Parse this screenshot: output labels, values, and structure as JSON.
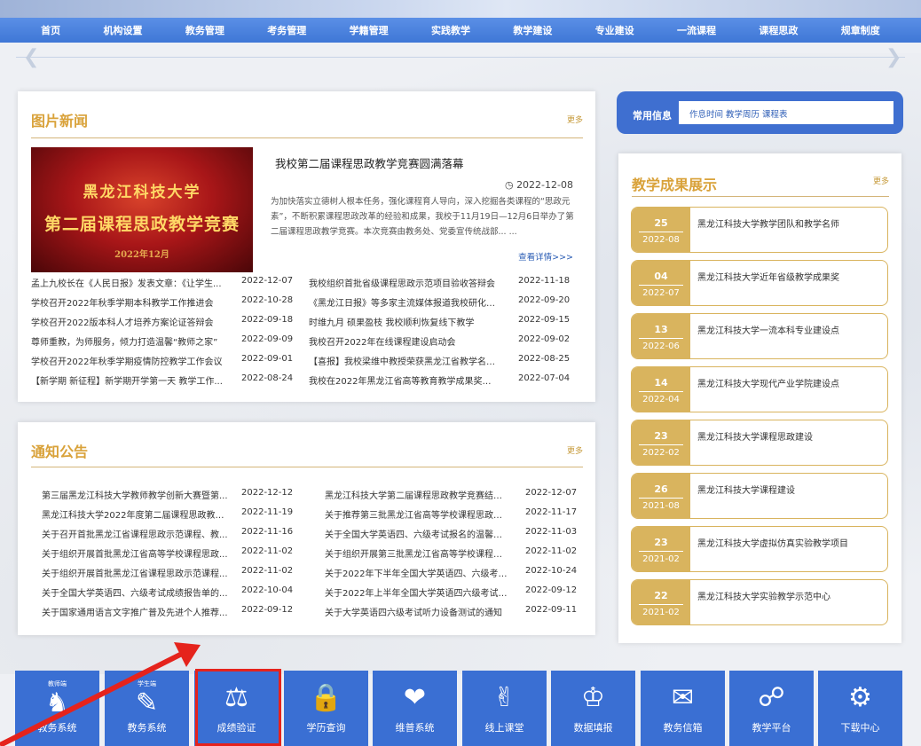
{
  "nav": [
    "首页",
    "机构设置",
    "教务管理",
    "考务管理",
    "学籍管理",
    "实践教学",
    "教学建设",
    "专业建设",
    "一流课程",
    "课程思政",
    "规章制度"
  ],
  "picnews": {
    "title": "图片新闻",
    "more": "更多",
    "feature": {
      "img_line1": "黑龙江科技大学",
      "img_line2": "第二届课程思政教学竞赛",
      "img_line3": "2022年12月",
      "title": "我校第二届课程思政教学竞赛圆满落幕",
      "date": "2022-12-08",
      "body": "为加快落实立德树人根本任务，强化课程育人导向，深入挖掘各类课程的“思政元素”，不断积累课程思政改革的经验和成果，我校于11月19日—12月6日举办了第二届课程思政教学竞赛。本次竞赛由教务处、党委宣传统战部...    ...",
      "detail": "查看详情>>>"
    },
    "items": [
      {
        "t": "孟上九校长在《人民日报》发表文章：《让学生...",
        "d": "2022-12-07"
      },
      {
        "t": "我校组织首批省级课程思政示范项目验收答辩会",
        "d": "2022-11-18"
      },
      {
        "t": "学校召开2022年秋季学期本科教学工作推进会",
        "d": "2022-10-28"
      },
      {
        "t": "《黑龙江日报》等多家主流媒体报道我校研化学...",
        "d": "2022-09-20"
      },
      {
        "t": "学校召开2022版本科人才培养方案论证答辩会",
        "d": "2022-09-18"
      },
      {
        "t": "时维九月 硕果盈枝 我校顺利恢复线下教学",
        "d": "2022-09-15"
      },
      {
        "t": "尊师重教，为师服务，倾力打造温馨“教师之家”",
        "d": "2022-09-09"
      },
      {
        "t": "我校召开2022年在线课程建设启动会",
        "d": "2022-09-02"
      },
      {
        "t": "学校召开2022年秋季学期疫情防控教学工作会议",
        "d": "2022-09-01"
      },
      {
        "t": "【喜报】我校梁维中教授荣获黑龙江省教学名师奖",
        "d": "2022-08-25"
      },
      {
        "t": "【新学期 新征程】新学期开学第一天 教学工作...",
        "d": "2022-08-24"
      },
      {
        "t": "我校在2022年黑龙江省高等教育教学成果奖评...",
        "d": "2022-07-04"
      }
    ]
  },
  "notice": {
    "title": "通知公告",
    "more": "更多",
    "items": [
      {
        "t": "第三届黑龙江科技大学教师教学创新大赛暨第...",
        "d": "2022-12-12"
      },
      {
        "t": "黑龙江科技大学第二届课程思政教学竞赛结果...",
        "d": "2022-12-07"
      },
      {
        "t": "黑龙江科技大学2022年度第二届课程思政教学...",
        "d": "2022-11-19"
      },
      {
        "t": "关于推荐第三批黑龙江省高等学校课程思政示...",
        "d": "2022-11-17"
      },
      {
        "t": "关于召开首批黑龙江省课程思政示范课程、教...",
        "d": "2022-11-16"
      },
      {
        "t": "关于全国大学英语四、六级考试报名的温馨提示",
        "d": "2022-11-03"
      },
      {
        "t": "关于组织开展首批黑龙江省高等学校课程思政...",
        "d": "2022-11-02"
      },
      {
        "t": "关于组织开展第三批黑龙江省高等学校课程思...",
        "d": "2022-11-02"
      },
      {
        "t": "关于组织开展首批黑龙江省课程思政示范课程...",
        "d": "2022-11-02"
      },
      {
        "t": "关于2022年下半年全国大学英语四、六级考试...",
        "d": "2022-10-24"
      },
      {
        "t": "关于全国大学英语四、六级考试成绩报告单的...",
        "d": "2022-10-04"
      },
      {
        "t": "关于2022年上半年全国大学英语四六级考试易...",
        "d": "2022-09-12"
      },
      {
        "t": "关于国家通用语言文字推广普及先进个人推荐...",
        "d": "2022-09-12"
      },
      {
        "t": "关于大学英语四六级考试听力设备测试的通知",
        "d": "2022-09-11"
      }
    ]
  },
  "quick": {
    "label": "常用信息",
    "links": "作息时间 教学周历 课程表"
  },
  "achievements": {
    "title": "教学成果展示",
    "more": "更多",
    "items": [
      {
        "day": "25",
        "ym": "2022-08",
        "t": "黑龙江科技大学教学团队和教学名师"
      },
      {
        "day": "04",
        "ym": "2022-07",
        "t": "黑龙江科技大学近年省级教学成果奖"
      },
      {
        "day": "13",
        "ym": "2022-06",
        "t": "黑龙江科技大学一流本科专业建设点"
      },
      {
        "day": "14",
        "ym": "2022-04",
        "t": "黑龙江科技大学现代产业学院建设点"
      },
      {
        "day": "23",
        "ym": "2022-02",
        "t": "黑龙江科技大学课程思政建设"
      },
      {
        "day": "26",
        "ym": "2021-08",
        "t": "黑龙江科技大学课程建设"
      },
      {
        "day": "23",
        "ym": "2021-02",
        "t": "黑龙江科技大学虚拟仿真实验教学项目"
      },
      {
        "day": "22",
        "ym": "2021-02",
        "t": "黑龙江科技大学实验教学示范中心"
      }
    ]
  },
  "tiles": [
    {
      "label": "教务系统",
      "tag": "教师端",
      "icon": "teacher-stamp-icon"
    },
    {
      "label": "教务系统",
      "tag": "学生端",
      "icon": "student-board-icon"
    },
    {
      "label": "成绩验证",
      "tag": "",
      "icon": "scales-icon"
    },
    {
      "label": "学历查询",
      "tag": "",
      "icon": "folder-lock-icon"
    },
    {
      "label": "维普系统",
      "tag": "",
      "icon": "hand-heart-icon"
    },
    {
      "label": "线上课堂",
      "tag": "",
      "icon": "handshake-icon"
    },
    {
      "label": "数据填报",
      "tag": "",
      "icon": "people-chart-icon"
    },
    {
      "label": "教务信箱",
      "tag": "",
      "icon": "mail-icon"
    },
    {
      "label": "教学平台",
      "tag": "",
      "icon": "link-icon"
    },
    {
      "label": "下载中心",
      "tag": "",
      "icon": "gear-people-icon"
    }
  ],
  "colors": {
    "nav": "#3f77d6",
    "gold": "#d9a23a",
    "tile": "#3a6fd3",
    "highlight": "#e5231c"
  }
}
